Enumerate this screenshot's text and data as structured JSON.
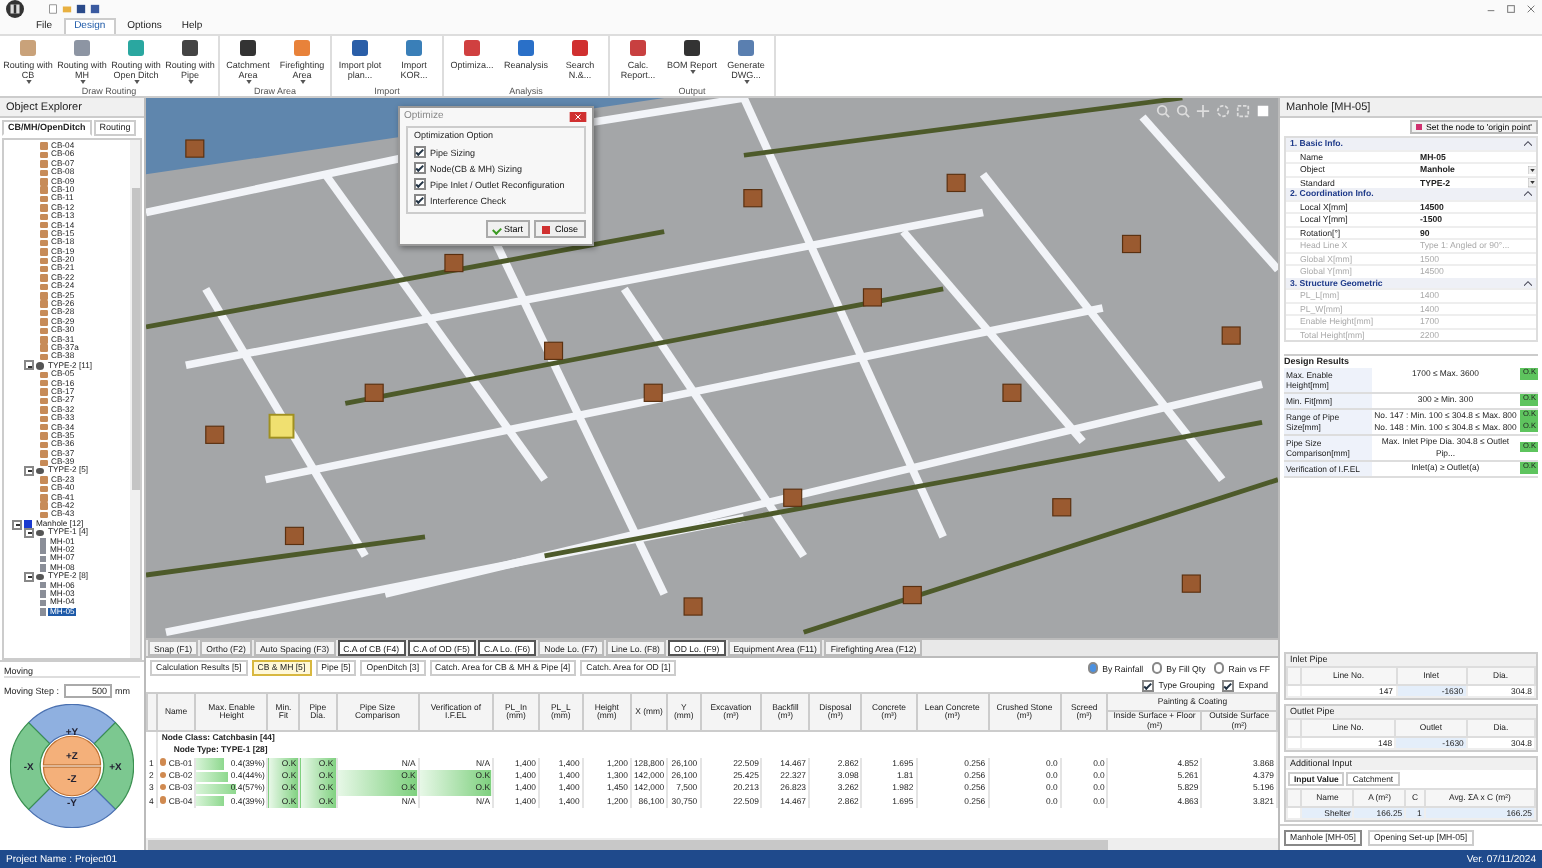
{
  "ribbon": {
    "tabs": [
      {
        "label": "File",
        "selected": false
      },
      {
        "label": "Design",
        "selected": true
      },
      {
        "label": "Options",
        "selected": false
      },
      {
        "label": "Help",
        "selected": false
      }
    ],
    "groups": [
      {
        "label": "Draw Routing",
        "buttons": [
          {
            "label": "Routing with CB",
            "dropdown": true
          },
          {
            "label": "Routing with MH",
            "dropdown": true
          },
          {
            "label": "Routing with Open Ditch",
            "dropdown": true
          },
          {
            "label": "Routing with Pipe",
            "dropdown": true
          }
        ]
      },
      {
        "label": "Draw Area",
        "buttons": [
          {
            "label": "Catchment Area",
            "dropdown": true
          },
          {
            "label": "Firefighting Area",
            "dropdown": true
          }
        ]
      },
      {
        "label": "Import",
        "buttons": [
          {
            "label": "Import plot plan...",
            "dropdown": false
          },
          {
            "label": "Import KOR...",
            "dropdown": false
          }
        ]
      },
      {
        "label": "Analysis",
        "buttons": [
          {
            "label": "Optimiza...",
            "dropdown": false
          },
          {
            "label": "Reanalysis",
            "dropdown": false
          },
          {
            "label": "Search N.&...",
            "dropdown": false
          }
        ]
      },
      {
        "label": "Output",
        "buttons": [
          {
            "label": "Calc. Report...",
            "dropdown": false
          },
          {
            "label": "BOM Report",
            "dropdown": true
          },
          {
            "label": "Generate DWG...",
            "dropdown": true
          }
        ]
      }
    ]
  },
  "explorer": {
    "title": "Object Explorer",
    "tabs": [
      {
        "label": "CB/MH/OpenDitch",
        "selected": true
      },
      {
        "label": "Routing",
        "selected": false
      }
    ],
    "tree": [
      {
        "label": "CB-04",
        "kind": "cb",
        "selected": false
      },
      {
        "label": "CB-06",
        "kind": "cb",
        "selected": false
      },
      {
        "label": "CB-07",
        "kind": "cb",
        "selected": false
      },
      {
        "label": "CB-08",
        "kind": "cb",
        "selected": false
      },
      {
        "label": "CB-09",
        "kind": "cb",
        "selected": false
      },
      {
        "label": "CB-10",
        "kind": "cb",
        "selected": false
      },
      {
        "label": "CB-11",
        "kind": "cb",
        "selected": false
      },
      {
        "label": "CB-12",
        "kind": "cb",
        "selected": false
      },
      {
        "label": "CB-13",
        "kind": "cb",
        "selected": false
      },
      {
        "label": "CB-14",
        "kind": "cb",
        "selected": false
      },
      {
        "label": "CB-15",
        "kind": "cb",
        "selected": false
      },
      {
        "label": "CB-18",
        "kind": "cb",
        "selected": false
      },
      {
        "label": "CB-19",
        "kind": "cb",
        "selected": false
      },
      {
        "label": "CB-20",
        "kind": "cb",
        "selected": false
      },
      {
        "label": "CB-21",
        "kind": "cb",
        "selected": false
      },
      {
        "label": "CB-22",
        "kind": "cb",
        "selected": false
      },
      {
        "label": "CB-24",
        "kind": "cb",
        "selected": false
      },
      {
        "label": "CB-25",
        "kind": "cb",
        "selected": false
      },
      {
        "label": "CB-26",
        "kind": "cb",
        "selected": false
      },
      {
        "label": "CB-28",
        "kind": "cb",
        "selected": false
      },
      {
        "label": "CB-29",
        "kind": "cb",
        "selected": false
      },
      {
        "label": "CB-30",
        "kind": "cb",
        "selected": false
      },
      {
        "label": "CB-31",
        "kind": "cb",
        "selected": false
      },
      {
        "label": "CB-37a",
        "kind": "cb",
        "selected": false
      },
      {
        "label": "CB-38",
        "kind": "cb",
        "selected": false
      },
      {
        "label": "TYPE-2 [11]",
        "kind": "type",
        "selected": false,
        "expanded": true,
        "children": [
          {
            "label": "CB-05",
            "kind": "cb",
            "selected": false
          },
          {
            "label": "CB-16",
            "kind": "cb",
            "selected": false
          },
          {
            "label": "CB-17",
            "kind": "cb",
            "selected": false
          },
          {
            "label": "CB-27",
            "kind": "cb",
            "selected": false
          },
          {
            "label": "CB-32",
            "kind": "cb",
            "selected": false
          },
          {
            "label": "CB-33",
            "kind": "cb",
            "selected": false
          },
          {
            "label": "CB-34",
            "kind": "cb",
            "selected": false
          },
          {
            "label": "CB-35",
            "kind": "cb",
            "selected": false
          },
          {
            "label": "CB-36",
            "kind": "cb",
            "selected": false
          },
          {
            "label": "CB-37",
            "kind": "cb",
            "selected": false
          },
          {
            "label": "CB-39",
            "kind": "cb",
            "selected": false
          }
        ]
      },
      {
        "label": "TYPE-2 [5]",
        "kind": "type",
        "selected": false,
        "expanded": true,
        "children": [
          {
            "label": "CB-23",
            "kind": "cb",
            "selected": false
          },
          {
            "label": "CB-40",
            "kind": "cb",
            "selected": false
          },
          {
            "label": "CB-41",
            "kind": "cb",
            "selected": false
          },
          {
            "label": "CB-42",
            "kind": "cb",
            "selected": false
          },
          {
            "label": "CB-43",
            "kind": "cb",
            "selected": false
          }
        ]
      },
      {
        "label": "Manhole [12]",
        "kind": "class",
        "selected": false,
        "expanded": true,
        "children": [
          {
            "label": "TYPE-1 [4]",
            "kind": "type",
            "selected": false,
            "expanded": true,
            "children": [
              {
                "label": "MH-01",
                "kind": "mh",
                "selected": false
              },
              {
                "label": "MH-02",
                "kind": "mh",
                "selected": false
              },
              {
                "label": "MH-07",
                "kind": "mh",
                "selected": false
              },
              {
                "label": "MH-08",
                "kind": "mh",
                "selected": false
              }
            ]
          },
          {
            "label": "TYPE-2 [8]",
            "kind": "type",
            "selected": false,
            "expanded": true,
            "children": [
              {
                "label": "MH-06",
                "kind": "mh",
                "selected": false
              },
              {
                "label": "MH-03",
                "kind": "mh",
                "selected": false
              },
              {
                "label": "MH-04",
                "kind": "mh",
                "selected": false
              },
              {
                "label": "MH-05",
                "kind": "mh",
                "selected": true
              }
            ]
          }
        ]
      }
    ]
  },
  "moving": {
    "title": "Moving",
    "step_label": "Moving Step :",
    "step_value": "500",
    "unit": "mm",
    "directions": [
      {
        "label": "+Y"
      },
      {
        "label": "+X"
      },
      {
        "label": "-Y"
      },
      {
        "label": "-X"
      },
      {
        "label": "+Z"
      },
      {
        "label": "-Z"
      }
    ]
  },
  "optimize_dialog": {
    "title": "Optimize",
    "group": "Optimization Option",
    "options": [
      {
        "label": "Pipe Sizing",
        "checked": true
      },
      {
        "label": "Node(CB & MH) Sizing",
        "checked": true
      },
      {
        "label": "Pipe Inlet / Outlet Reconfiguration",
        "checked": true
      },
      {
        "label": "Interference Check",
        "checked": true
      }
    ],
    "buttons": [
      {
        "label": "Start"
      },
      {
        "label": "Close"
      }
    ]
  },
  "snap_tabs": [
    {
      "label": "Snap (F1)",
      "on": false
    },
    {
      "label": "Ortho (F2)",
      "on": false
    },
    {
      "label": "Auto Spacing (F3)",
      "on": false
    },
    {
      "label": "C.A of CB (F4)",
      "on": true
    },
    {
      "label": "C.A of OD (F5)",
      "on": true
    },
    {
      "label": "C.A Lo. (F6)",
      "on": true
    },
    {
      "label": "Node Lo. (F7)",
      "on": false
    },
    {
      "label": "Line Lo. (F8)",
      "on": false
    },
    {
      "label": "OD Lo. (F9)",
      "on": true
    },
    {
      "label": "Equipment Area (F11)",
      "on": false
    },
    {
      "label": "Firefighting Area (F12)",
      "on": false
    }
  ],
  "results": {
    "tabs": [
      {
        "label": "Calculation Results [5]",
        "selected": false
      },
      {
        "label": "CB & MH [5]",
        "selected": true
      },
      {
        "label": "Pipe [5]",
        "selected": false
      },
      {
        "label": "OpenDitch [3]",
        "selected": false
      },
      {
        "label": "Catch. Area for CB & MH & Pipe [4]",
        "selected": false
      },
      {
        "label": "Catch. Area for OD [1]",
        "selected": false
      }
    ],
    "radios": [
      {
        "label": "By Rainfall",
        "selected": true
      },
      {
        "label": "By Fill Qty",
        "selected": false
      },
      {
        "label": "Rain vs FF",
        "selected": false
      }
    ],
    "checks": [
      {
        "label": "Type Grouping",
        "checked": true
      },
      {
        "label": "Expand",
        "checked": true
      }
    ],
    "column_group": "Painting & Coating",
    "columns": [
      "Name",
      "Max. Enable Height",
      "Min. Fit",
      "Pipe Dia.",
      "Pipe Size Comparison",
      "Verification of I.F.EL",
      "PL_In (mm)",
      "PL_L (mm)",
      "Height (mm)",
      "X (mm)",
      "Y (mm)",
      "Excavation (m³)",
      "Backfill (m³)",
      "Disposal (m³)",
      "Concrete (m³)",
      "Lean Concrete (m³)",
      "Crushed Stone (m³)",
      "Screed (m³)",
      "Inside Surface + Floor (m²)",
      "Outside Surface (m²)"
    ],
    "groups": [
      "Node Class: Catchbasin [44]",
      "Node Type: TYPE-1 [28]"
    ],
    "rows": [
      {
        "no": "1",
        "name": "CB-01",
        "height": {
          "text": "0.4(39%)",
          "level": 0.39
        },
        "status": [
          {
            "text": "O.K",
            "ok": true
          },
          {
            "text": "O.K",
            "ok": true
          },
          {
            "text": "N/A",
            "ok": false
          },
          {
            "text": "N/A",
            "ok": false
          }
        ],
        "values": [
          "1,400",
          "1,400",
          "1,200",
          "128,800",
          "26,100",
          "22.509",
          "14.467",
          "2.862",
          "1.695",
          "0.256",
          "0.0",
          "0.0",
          "4.852",
          "3.868"
        ]
      },
      {
        "no": "2",
        "name": "CB-02",
        "height": {
          "text": "0.4(44%)",
          "level": 0.44
        },
        "status": [
          {
            "text": "O.K",
            "ok": true
          },
          {
            "text": "O.K",
            "ok": true
          },
          {
            "text": "O.K",
            "ok": true
          },
          {
            "text": "O.K",
            "ok": true
          }
        ],
        "values": [
          "1,400",
          "1,400",
          "1,300",
          "142,000",
          "26,100",
          "25.425",
          "22.327",
          "3.098",
          "1.81",
          "0.256",
          "0.0",
          "0.0",
          "5.261",
          "4.379"
        ]
      },
      {
        "no": "3",
        "name": "CB-03",
        "height": {
          "text": "0.4(57%)",
          "level": 0.57
        },
        "status": [
          {
            "text": "O.K",
            "ok": true
          },
          {
            "text": "O.K",
            "ok": true
          },
          {
            "text": "O.K",
            "ok": true
          },
          {
            "text": "O.K",
            "ok": true
          }
        ],
        "values": [
          "1,400",
          "1,400",
          "1,450",
          "142,000",
          "7,500",
          "20.213",
          "26.823",
          "3.262",
          "1.982",
          "0.256",
          "0.0",
          "0.0",
          "5.829",
          "5.196"
        ]
      },
      {
        "no": "4",
        "name": "CB-04",
        "height": {
          "text": "0.4(39%)",
          "level": 0.39
        },
        "status": [
          {
            "text": "O.K",
            "ok": true
          },
          {
            "text": "O.K",
            "ok": true
          },
          {
            "text": "N/A",
            "ok": false
          },
          {
            "text": "N/A",
            "ok": false
          }
        ],
        "values": [
          "1,400",
          "1,400",
          "1,200",
          "86,100",
          "30,750",
          "22.509",
          "14.467",
          "2.862",
          "1.695",
          "0.256",
          "0.0",
          "0.0",
          "4.863",
          "3.821"
        ]
      }
    ]
  },
  "properties": {
    "title": "Manhole [MH-05]",
    "origin_button": "Set the node to 'origin point'",
    "sections": [
      {
        "title": "1. Basic Info.",
        "expanded": true,
        "rows": [
          {
            "label": "Name",
            "value": "MH-05",
            "disabled": false,
            "select": false
          },
          {
            "label": "Object",
            "value": "Manhole",
            "disabled": false,
            "select": true
          },
          {
            "label": "Standard",
            "value": "TYPE-2",
            "disabled": false,
            "select": true
          }
        ]
      },
      {
        "title": "2. Coordination Info.",
        "expanded": true,
        "rows": [
          {
            "label": "Local X[mm]",
            "value": "14500",
            "disabled": false,
            "select": false
          },
          {
            "label": "Local Y[mm]",
            "value": "-1500",
            "disabled": false,
            "select": false
          },
          {
            "label": "Rotation[°]",
            "value": "90",
            "disabled": false,
            "select": false
          },
          {
            "label": "Head Line X",
            "value": "Type 1: Angled or 90°...",
            "disabled": true,
            "select": false
          },
          {
            "label": "Global X[mm]",
            "value": "1500",
            "disabled": true,
            "select": false
          },
          {
            "label": "Global Y[mm]",
            "value": "14500",
            "disabled": true,
            "select": false
          }
        ]
      },
      {
        "title": "3. Structure Geometric",
        "expanded": true,
        "rows": [
          {
            "label": "PL_L[mm]",
            "value": "1400",
            "disabled": true,
            "select": false
          },
          {
            "label": "PL_W[mm]",
            "value": "1400",
            "disabled": true,
            "select": false
          },
          {
            "label": "Enable Height[mm]",
            "value": "1700",
            "disabled": true,
            "select": false
          },
          {
            "label": "Total Height[mm]",
            "value": "2200",
            "disabled": true,
            "select": false
          }
        ]
      }
    ]
  },
  "design_results": {
    "title": "Design Results",
    "rows": [
      {
        "label": "Max. Enable Height[mm]",
        "values": [
          {
            "text": "1700 ≤ Max. 3600",
            "result": "O.K"
          }
        ]
      },
      {
        "label": "Min. Fit[mm]",
        "values": [
          {
            "text": "300 ≥ Min. 300",
            "result": "O.K"
          }
        ]
      },
      {
        "label": "Range of Pipe Size[mm]",
        "values": [
          {
            "text": "No. 147 : Min. 100 ≤ 304.8 ≤ Max. 800",
            "result": "O.K"
          },
          {
            "text": "No. 148 : Min. 100 ≤ 304.8 ≤ Max. 800",
            "result": "O.K"
          }
        ]
      },
      {
        "label": "Pipe Size Comparison[mm]",
        "values": [
          {
            "text": "Max. Inlet Pipe Dia. 304.8 ≤ Outlet Pip...",
            "result": "O.K"
          }
        ]
      },
      {
        "label": "Verification of I.F.EL",
        "values": [
          {
            "text": "Inlet(a) ≥ Outlet(a)",
            "result": "O.K"
          }
        ]
      }
    ]
  },
  "inlet_pipe": {
    "title": "Inlet Pipe",
    "columns": [
      "Line No.",
      "Inlet",
      "Dia."
    ],
    "rows": [
      [
        "147",
        "-1630",
        "304.8"
      ]
    ]
  },
  "outlet_pipe": {
    "title": "Outlet Pipe",
    "columns": [
      "Line No.",
      "Outlet",
      "Dia."
    ],
    "rows": [
      [
        "148",
        "-1630",
        "304.8"
      ]
    ]
  },
  "additional_input": {
    "title": "Additional Input",
    "tabs": [
      {
        "label": "Input Value",
        "selected": true
      },
      {
        "label": "Catchment",
        "selected": false
      }
    ],
    "columns": [
      "Name",
      "A (m²)",
      "C",
      "Avg. ΣA x C (m²)"
    ],
    "rows": [
      [
        "Shelter",
        "166.25",
        "1",
        "166.25"
      ]
    ]
  },
  "panel_tabs": [
    {
      "label": "Manhole [MH-05]",
      "selected": true
    },
    {
      "label": "Opening Set-up [MH-05]",
      "selected": false
    }
  ],
  "status_bar": {
    "project": "Project Name : Project01",
    "version": "Ver. 07/11/2024"
  }
}
